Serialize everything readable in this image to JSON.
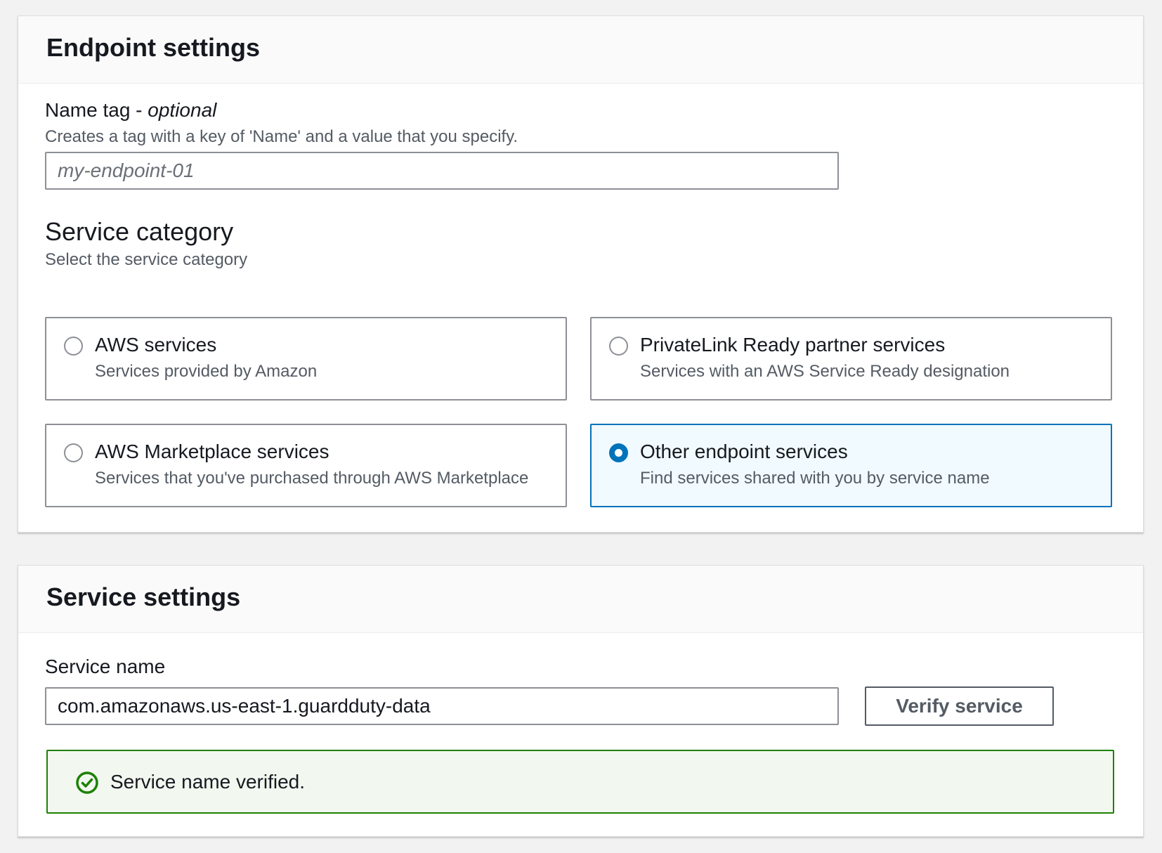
{
  "endpoint_settings": {
    "title": "Endpoint settings",
    "name_tag": {
      "label": "Name tag - ",
      "label_optional": "optional",
      "description": "Creates a tag with a key of 'Name' and a value that you specify.",
      "placeholder": "my-endpoint-01",
      "value": ""
    },
    "service_category": {
      "heading": "Service category",
      "description": "Select the service category",
      "selected": "Other endpoint services",
      "options": [
        {
          "title": "AWS services",
          "description": "Services provided by Amazon",
          "selected": false
        },
        {
          "title": "PrivateLink Ready partner services",
          "description": "Services with an AWS Service Ready designation",
          "selected": false
        },
        {
          "title": "AWS Marketplace services",
          "description": "Services that you've purchased through AWS Marketplace",
          "selected": false
        },
        {
          "title": "Other endpoint services",
          "description": "Find services shared with you by service name",
          "selected": true
        }
      ]
    }
  },
  "service_settings": {
    "title": "Service settings",
    "service_name": {
      "label": "Service name",
      "value": "com.amazonaws.us-east-1.guardduty-data"
    },
    "verify_button_label": "Verify service",
    "alert": {
      "type": "success",
      "text": "Service name verified."
    }
  },
  "colors": {
    "accent": "#0073bb",
    "selected_tile_bg": "#f1faff",
    "success": "#1d8102",
    "success_bg": "#f2f8f0",
    "page_bg": "#f2f2f2"
  },
  "icons": {
    "radio_selected": "radio-selected-icon",
    "radio_unselected": "radio-unselected-icon",
    "success": "check-circle-icon"
  }
}
